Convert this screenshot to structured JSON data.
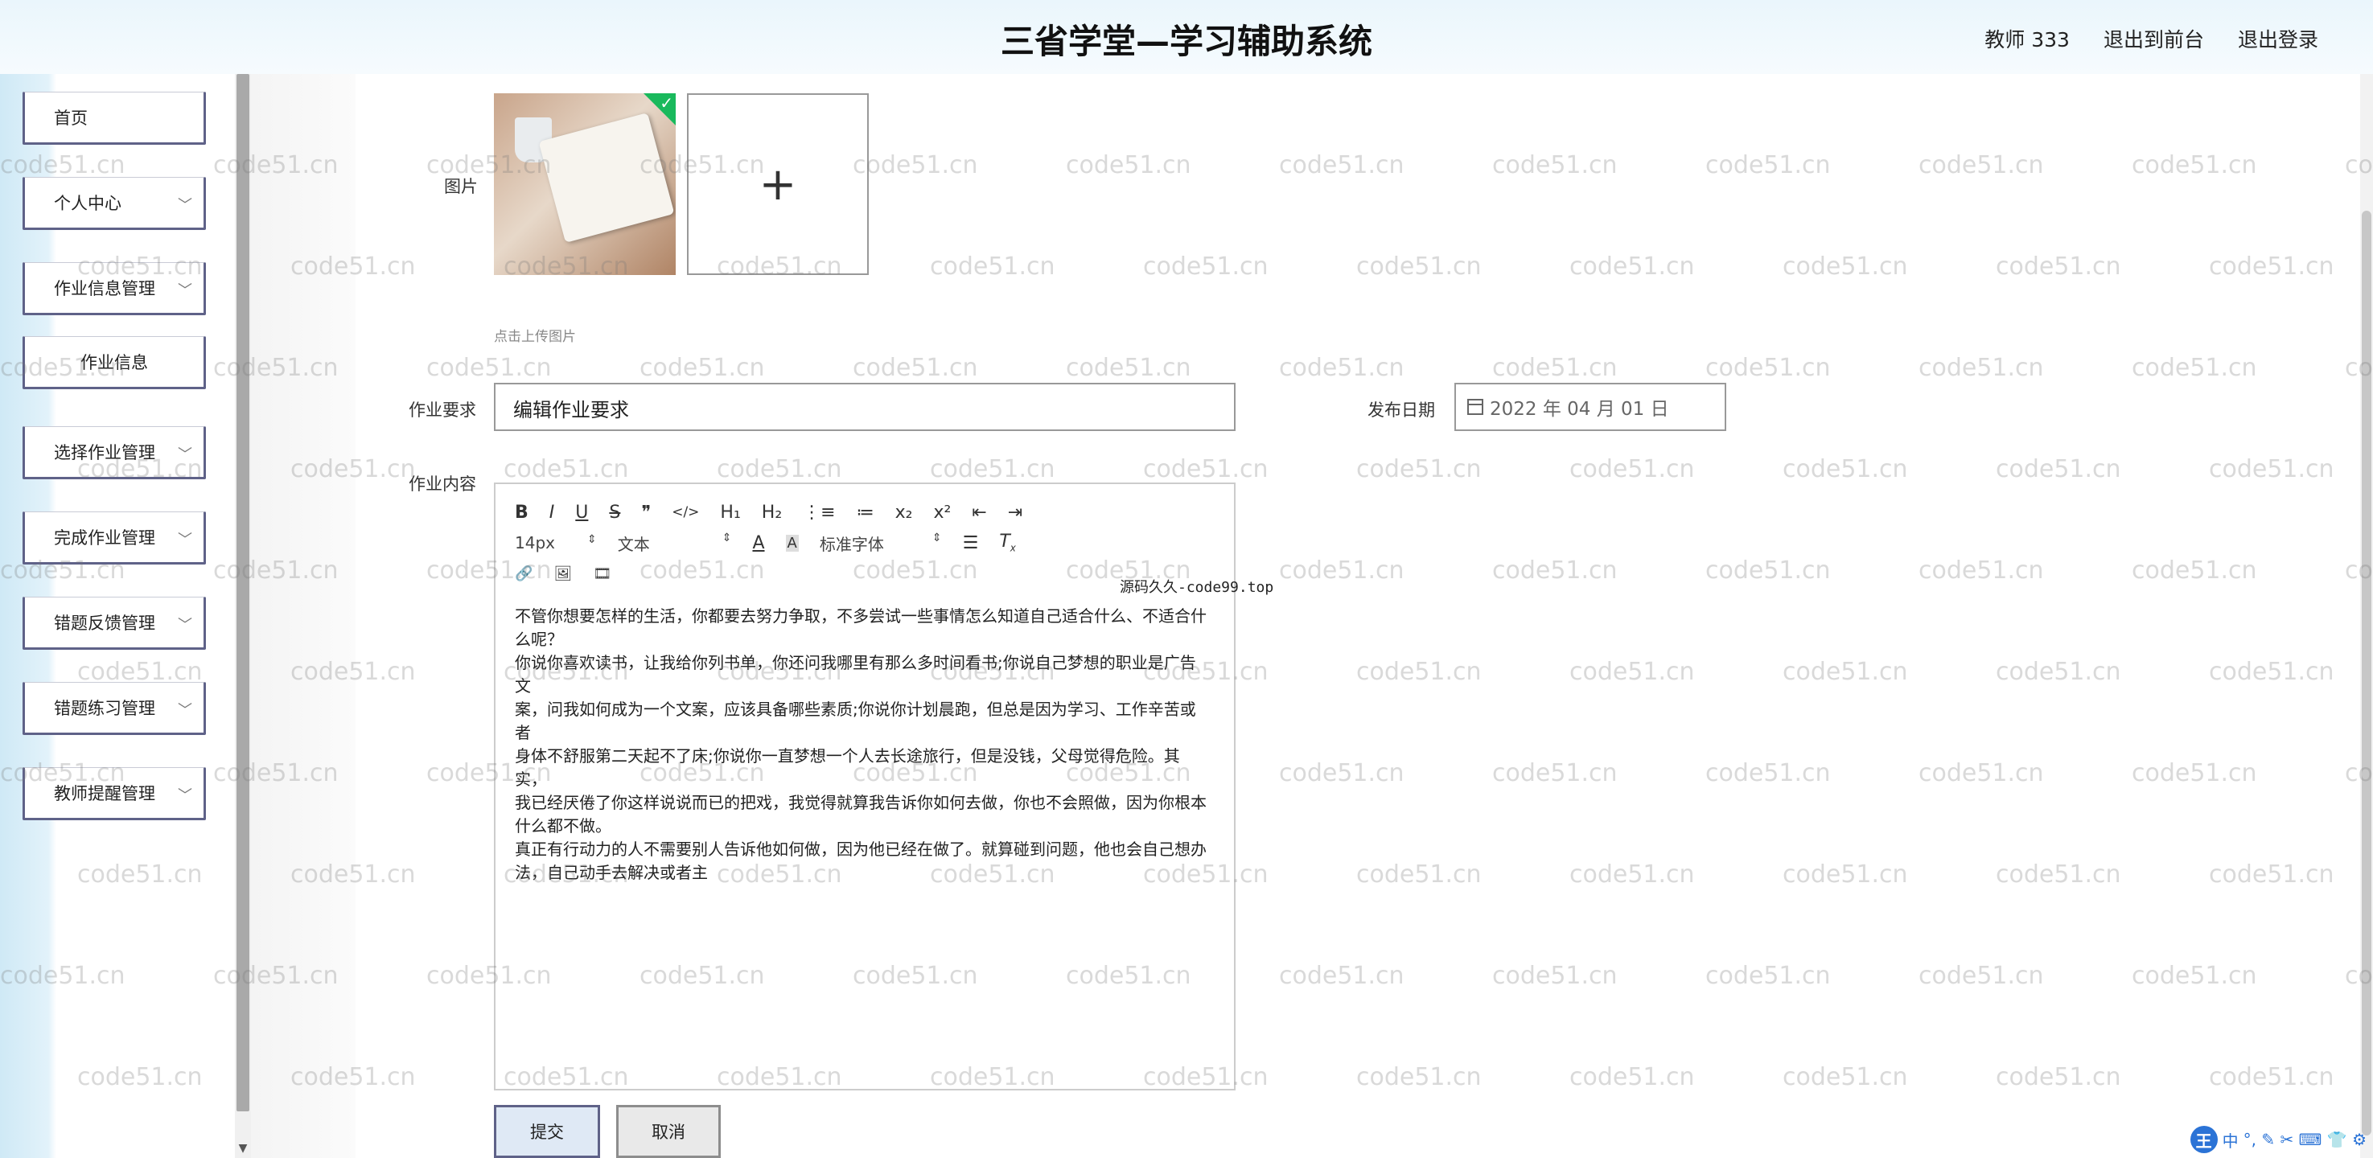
{
  "header": {
    "title": "三省学堂—学习辅助系统",
    "user": "教师 333",
    "frontend_link": "退出到前台",
    "logout_link": "退出登录"
  },
  "sidebar": {
    "items": [
      {
        "label": "首页",
        "chevron": false
      },
      {
        "label": "个人中心",
        "chevron": true
      },
      {
        "label": "作业信息管理",
        "chevron": true
      },
      {
        "label": "作业信息",
        "chevron": false
      },
      {
        "label": "选择作业管理",
        "chevron": true
      },
      {
        "label": "完成作业管理",
        "chevron": true
      },
      {
        "label": "错题反馈管理",
        "chevron": true
      },
      {
        "label": "错题练习管理",
        "chevron": true
      },
      {
        "label": "教师提醒管理",
        "chevron": true
      }
    ],
    "chevron_glyph": "﹀"
  },
  "form": {
    "image_label": "图片",
    "upload_plus": "+",
    "upload_hint": "点击上传图片",
    "requirement_label": "作业要求",
    "requirement_value": "编辑作业要求",
    "date_label": "发布日期",
    "date_value": "2022 年 04 月 01 日",
    "content_label": "作业内容"
  },
  "editor": {
    "toolbar_row1": [
      "B",
      "I",
      "U",
      "S",
      "❞",
      "</>",
      "H₁",
      "H₂",
      "⋮≡",
      "≔",
      "x₂",
      "x²",
      "⇤",
      "⇥"
    ],
    "font_size": "14px",
    "text_type": "文本",
    "font_family": "标准字体",
    "toolbar_row3": [
      "🔗",
      "🖼",
      "🎞"
    ],
    "content_lines": [
      "不管你想要怎样的生活，你都要去努力争取，不多尝试一些事情怎么知道自己适合什么、不适合什",
      "么呢？",
      "你说你喜欢读书，让我给你列书单，你还问我哪里有那么多时间看书;你说自己梦想的职业是广告文",
      "案，问我如何成为一个文案，应该具备哪些素质;你说你计划晨跑，但总是因为学习、工作辛苦或者",
      "身体不舒服第二天起不了床;你说你一直梦想一个人去长途旅行，但是没钱，父母觉得危险。其实，",
      "我已经厌倦了你这样说说而已的把戏，我觉得就算我告诉你如何去做，你也不会照做，因为你根本",
      "什么都不做。",
      "真正有行动力的人不需要别人告诉他如何做，因为他已经在做了。就算碰到问题，他也会自己想办",
      "法，自己动手去解决或者主"
    ],
    "source_watermark": "源码久久-code99.top"
  },
  "buttons": {
    "submit": "提交",
    "cancel": "取消"
  },
  "ime": {
    "logo": "王",
    "mode": "中",
    "icons": "°, ✎ ✂ ⌨ 👕 ⚙"
  },
  "watermark": "code51.cn",
  "colors": {
    "header_bg": "#eaf6fc",
    "menu_border": "#5f6288",
    "submit_bg": "#dfe9f5"
  }
}
